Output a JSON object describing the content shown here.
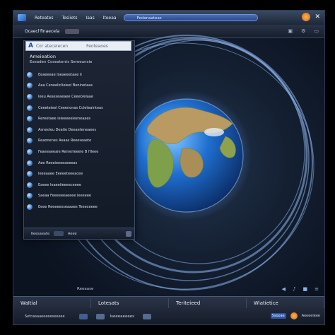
{
  "topbar": {
    "items": [
      "Reteates",
      "Tesiiets",
      "Iaas",
      "Iteeaa",
      "Ieeetanaas"
    ],
    "search_text": "Fedanaateas",
    "close_label": "✕"
  },
  "addrbar": {
    "text": "Ocaecl'finaecela",
    "icons": [
      "▣",
      "⚙",
      "▭"
    ]
  },
  "panel": {
    "search_letter": "A",
    "search_placeholder": "Cor ateceiecen",
    "search_placeholder2": "Feoteaoes",
    "title": "Ameieation",
    "subtitle": "Eseaden Coseatents  Sereeunsie",
    "rows": [
      "Eeaeeeae  Ioeaeeetaae  Ii",
      "Aaa  Ceneeliclieieel Beninetaas",
      "Ieeu  Aeasseaeaee Ceeeoleiaae",
      "Ceeeteieel  Ceeenonas  Ccleteainteas",
      "Rereetaee  ieieeeeeieeneaaes",
      "Asnesteu  Deatie  Deeaeteneaees",
      "Reaonenes  Aeaas  Reeeseaete",
      "Feaeeaeeaie  Renierieeeie B  Hleee",
      "Aee  Reeeieeeeaeeeas",
      "Ieeeaaee  Eeeeeteeeacee",
      "Eaeee  Ieaeeiieeeeceeee",
      "Saeaa  Feeeeeeaeeee  Ieeeeee",
      "Eeee  Reeeeesseaaaes  Teeeceeee"
    ],
    "foot": [
      "Keesaeate",
      "Aeee"
    ]
  },
  "strip": {
    "label": "Reeaase"
  },
  "bottombar": {
    "tabs": [
      "WaItial",
      "Lotesats",
      "Teriteieed",
      "Wiatietice"
    ],
    "row_text": "Setnasaaeeeeeseeeee",
    "row_label": "Iseeeaeeees",
    "btn": "Ssooae",
    "right_label": "Aeeeeieee"
  },
  "colors": {
    "accent": "#2f71c7",
    "ring": "#7fa9e8",
    "ocean": "#1f6fd0",
    "land": "#c9a46a"
  }
}
